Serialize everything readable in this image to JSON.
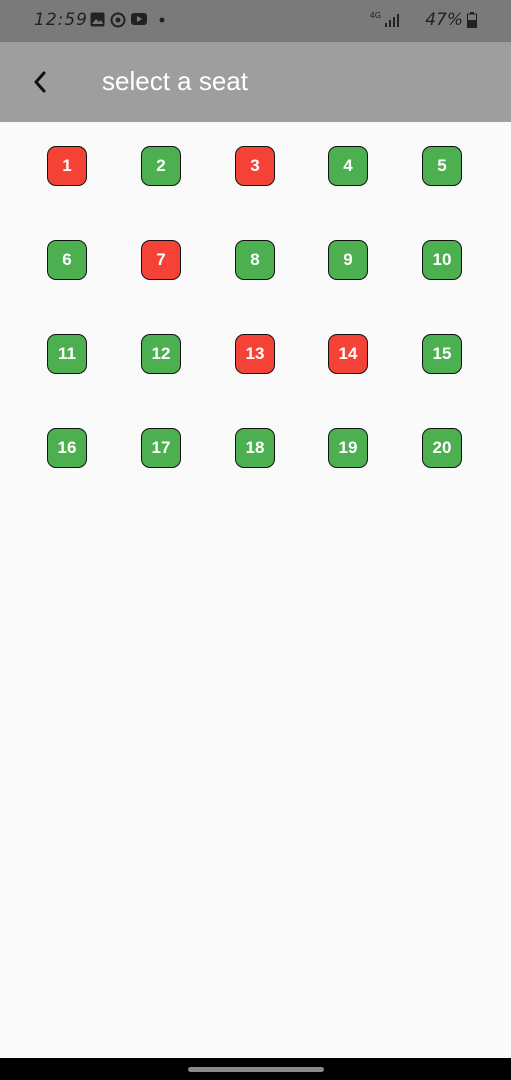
{
  "status_bar": {
    "time": "12:59",
    "network": "4G",
    "battery_percent": "47%"
  },
  "app_bar": {
    "title": "select a seat"
  },
  "colors": {
    "available": "#4caf50",
    "booked": "#f44336"
  },
  "seats": [
    {
      "label": "1",
      "status": "booked"
    },
    {
      "label": "2",
      "status": "available"
    },
    {
      "label": "3",
      "status": "booked"
    },
    {
      "label": "4",
      "status": "available"
    },
    {
      "label": "5",
      "status": "available"
    },
    {
      "label": "6",
      "status": "available"
    },
    {
      "label": "7",
      "status": "booked"
    },
    {
      "label": "8",
      "status": "available"
    },
    {
      "label": "9",
      "status": "available"
    },
    {
      "label": "10",
      "status": "available"
    },
    {
      "label": "11",
      "status": "available"
    },
    {
      "label": "12",
      "status": "available"
    },
    {
      "label": "13",
      "status": "booked"
    },
    {
      "label": "14",
      "status": "booked"
    },
    {
      "label": "15",
      "status": "available"
    },
    {
      "label": "16",
      "status": "available"
    },
    {
      "label": "17",
      "status": "available"
    },
    {
      "label": "18",
      "status": "available"
    },
    {
      "label": "19",
      "status": "available"
    },
    {
      "label": "20",
      "status": "available"
    }
  ]
}
